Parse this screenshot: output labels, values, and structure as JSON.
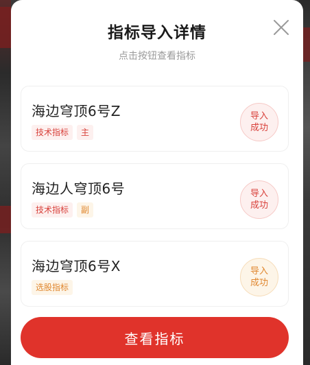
{
  "dialog": {
    "title": "指标导入详情",
    "subtitle": "点击按钮查看指标",
    "close_icon": "close-icon"
  },
  "items": [
    {
      "name": "海边穹顶6号Z",
      "tags": [
        {
          "label": "技术指标",
          "color": "#d8413b"
        },
        {
          "label": "主",
          "color": "#d8413b"
        }
      ],
      "status_line1": "导入",
      "status_line2": "成功",
      "status_color": "#d8413b"
    },
    {
      "name": "海边人穹顶6号",
      "tags": [
        {
          "label": "技术指标",
          "color": "#d8413b"
        },
        {
          "label": "副",
          "color": "#e0872f"
        }
      ],
      "status_line1": "导入",
      "status_line2": "成功",
      "status_color": "#d8413b"
    },
    {
      "name": "海边穹顶6号X",
      "tags": [
        {
          "label": "选股指标",
          "color": "#e0872f"
        }
      ],
      "status_line1": "导入",
      "status_line2": "成功",
      "status_color": "#e0872f"
    }
  ],
  "footer": {
    "view_button_label": "查看指标",
    "accent_color": "#e0332b"
  }
}
